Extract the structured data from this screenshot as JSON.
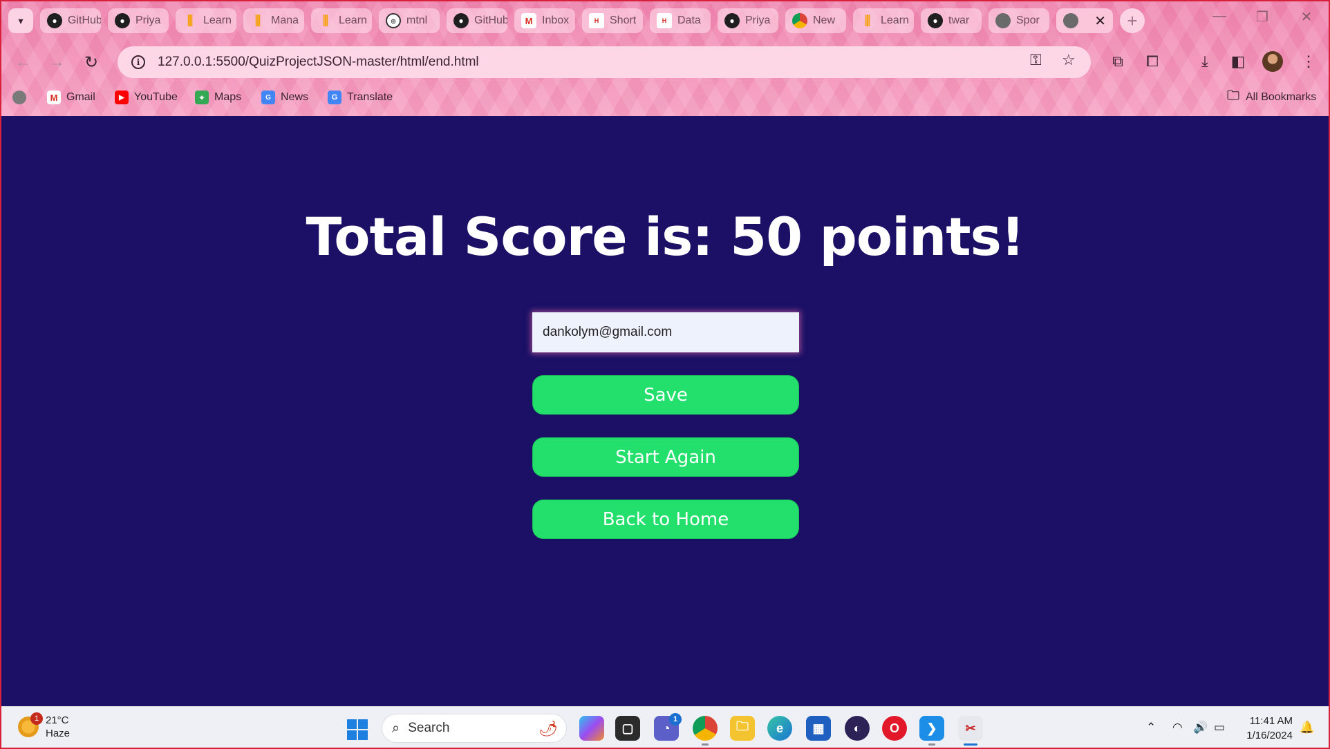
{
  "browser": {
    "tabs": [
      {
        "label": "GitHub",
        "icon": "github-icon"
      },
      {
        "label": "Priya",
        "icon": "github-icon"
      },
      {
        "label": "Learn",
        "icon": "learn-icon"
      },
      {
        "label": "Mana",
        "icon": "learn-icon"
      },
      {
        "label": "Learn",
        "icon": "learn-icon"
      },
      {
        "label": "mtnl",
        "icon": "mtnl-icon"
      },
      {
        "label": "GitHub",
        "icon": "github-icon"
      },
      {
        "label": "Inbox",
        "icon": "gmail-icon"
      },
      {
        "label": "Short",
        "icon": "hot-icon"
      },
      {
        "label": "Data",
        "icon": "hot-icon"
      },
      {
        "label": "Priya",
        "icon": "github-icon"
      },
      {
        "label": "New",
        "icon": "chrome-icon"
      },
      {
        "label": "Learn",
        "icon": "learn-icon"
      },
      {
        "label": "twar",
        "icon": "github-icon"
      },
      {
        "label": "Spor",
        "icon": "globe-icon"
      }
    ],
    "active_tab_close": "✕",
    "url": "127.0.0.1:5500/QuizProjectJSON-master/html/end.html",
    "bookmarks": [
      {
        "label": "Gmail",
        "icon": "gmail-icon"
      },
      {
        "label": "YouTube",
        "icon": "youtube-icon"
      },
      {
        "label": "Maps",
        "icon": "maps-icon"
      },
      {
        "label": "News",
        "icon": "news-icon"
      },
      {
        "label": "Translate",
        "icon": "translate-icon"
      }
    ],
    "all_bookmarks": "All Bookmarks",
    "theme_color": "#f08ab3"
  },
  "page": {
    "title": "Total Score is: 50 points!",
    "email_value": "dankolym@gmail.com",
    "save_label": "Save",
    "start_again_label": "Start Again",
    "back_home_label": "Back to Home",
    "background_color": "#1b0f66",
    "button_color": "#22e06b"
  },
  "taskbar": {
    "weather_temp": "21°C",
    "weather_desc": "Haze",
    "weather_badge": "1",
    "search_label": "Search",
    "teams_badge": "1",
    "time": "11:41 AM",
    "date": "1/16/2024"
  }
}
